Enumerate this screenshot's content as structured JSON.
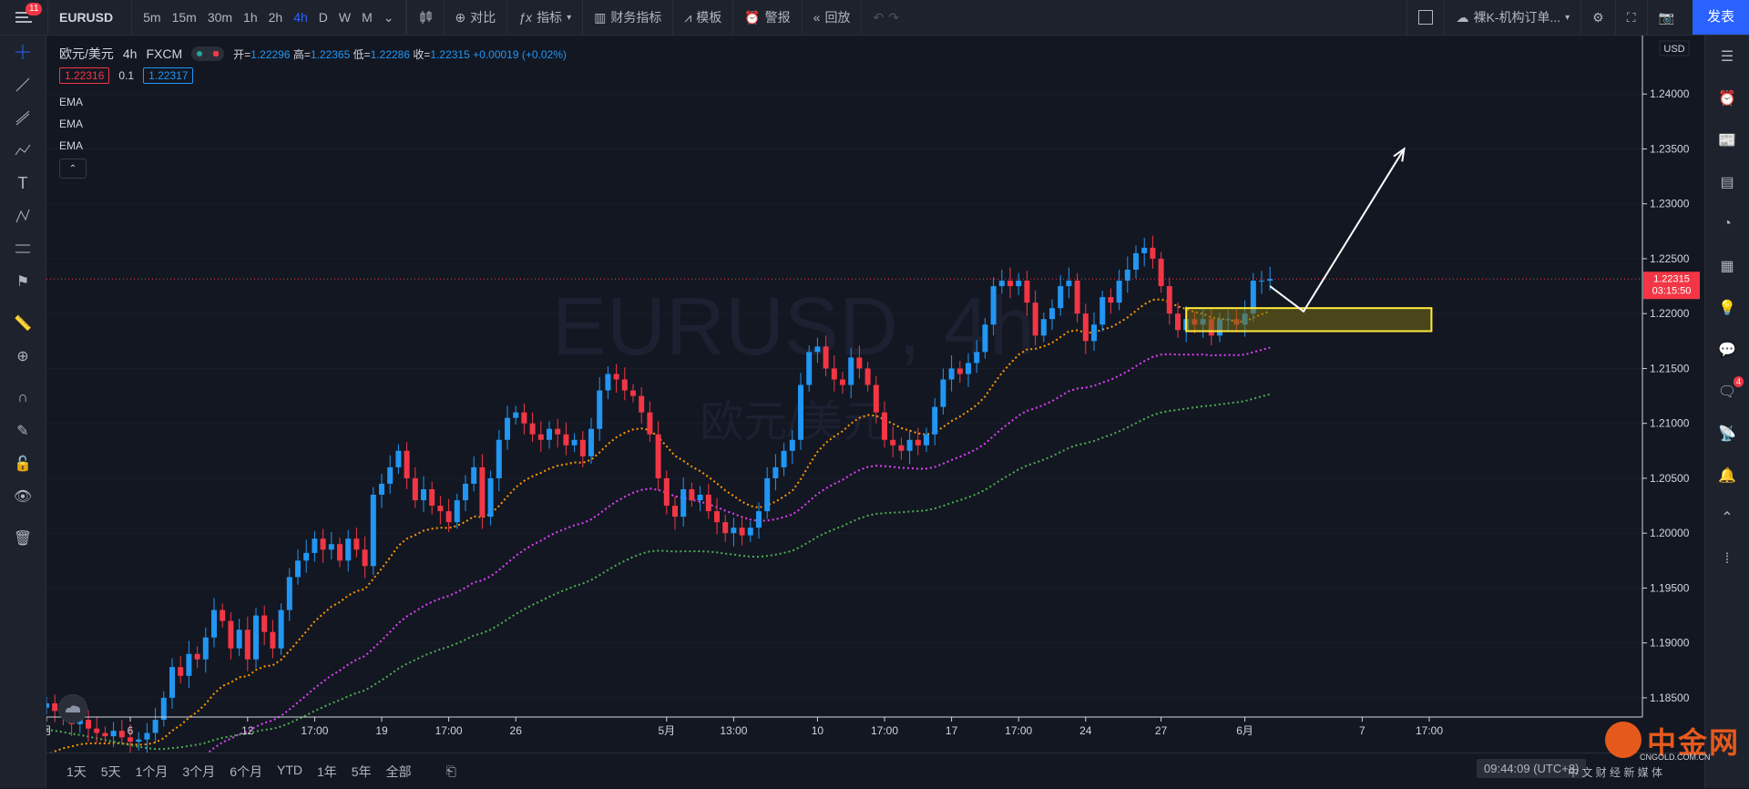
{
  "topbar": {
    "menu_badge": "11",
    "symbol": "EURUSD",
    "intervals": [
      "5m",
      "15m",
      "30m",
      "1h",
      "2h",
      "4h",
      "D",
      "W",
      "M"
    ],
    "active_interval": "4h",
    "compare": "对比",
    "indicators": "指标",
    "financials": "财务指标",
    "template": "模板",
    "alert": "警报",
    "replay": "回放",
    "layout_name": "裸K-机构订单...",
    "publish": "发表"
  },
  "legend": {
    "title": "欧元/美元",
    "interval": "4h",
    "broker": "FXCM",
    "open_label": "开=",
    "open": "1.22296",
    "high_label": "高=",
    "high": "1.22365",
    "low_label": "低=",
    "low": "1.22286",
    "close_label": "收=",
    "close": "1.22315",
    "change": "+0.00019 (+0.02%)",
    "sell": "1.22316",
    "spread": "0.1",
    "buy": "1.22317",
    "indicators": [
      "EMA",
      "EMA",
      "EMA"
    ]
  },
  "watermark": {
    "symbol": "EURUSD, 4h",
    "name": "欧元/美元"
  },
  "chart_data": {
    "type": "candlestick",
    "currency": "USD",
    "last_price": "1.22315",
    "countdown": "03:15:50",
    "y_ticks": [
      "1.24000",
      "1.23500",
      "1.23000",
      "1.22500",
      "1.22000",
      "1.21500",
      "1.21000",
      "1.20500",
      "1.20000",
      "1.19500",
      "1.19000",
      "1.18500"
    ],
    "ylim": [
      1.1835,
      1.2445
    ],
    "x_ticks": [
      {
        "label": "月",
        "i": 0
      },
      {
        "label": "6",
        "i": 10
      },
      {
        "label": "12",
        "i": 24
      },
      {
        "label": "17:00",
        "i": 32
      },
      {
        "label": "19",
        "i": 40
      },
      {
        "label": "17:00",
        "i": 48
      },
      {
        "label": "26",
        "i": 56
      },
      {
        "label": "5月",
        "i": 74
      },
      {
        "label": "13:00",
        "i": 82
      },
      {
        "label": "10",
        "i": 92
      },
      {
        "label": "17:00",
        "i": 100
      },
      {
        "label": "17",
        "i": 108
      },
      {
        "label": "17:00",
        "i": 116
      },
      {
        "label": "24",
        "i": 124
      },
      {
        "label": "27",
        "i": 133
      },
      {
        "label": "6月",
        "i": 143
      },
      {
        "label": "7",
        "i": 157
      },
      {
        "label": "17:00",
        "i": 165
      }
    ],
    "close": [
      1.1845,
      1.1838,
      1.1832,
      1.1826,
      1.183,
      1.1822,
      1.1818,
      1.1815,
      1.182,
      1.1814,
      1.181,
      1.1812,
      1.1818,
      1.183,
      1.185,
      1.1878,
      1.187,
      1.189,
      1.1885,
      1.1905,
      1.193,
      1.192,
      1.1895,
      1.1912,
      1.1885,
      1.1925,
      1.191,
      1.1895,
      1.193,
      1.196,
      1.1975,
      1.1982,
      1.1995,
      1.1985,
      1.199,
      1.1975,
      1.1995,
      1.1985,
      1.197,
      1.2035,
      1.2045,
      1.206,
      1.2075,
      1.205,
      1.203,
      1.204,
      1.2025,
      1.202,
      1.201,
      1.203,
      1.2045,
      1.206,
      1.2015,
      1.205,
      1.2085,
      1.2105,
      1.211,
      1.21,
      1.209,
      1.2085,
      1.2095,
      1.209,
      1.208,
      1.2085,
      1.207,
      1.2095,
      1.213,
      1.2145,
      1.214,
      1.213,
      1.2125,
      1.211,
      1.209,
      1.205,
      1.2025,
      1.2015,
      1.204,
      1.203,
      1.2035,
      1.202,
      1.201,
      1.2,
      1.2005,
      1.1998,
      1.2005,
      1.202,
      1.205,
      1.206,
      1.2075,
      1.2085,
      1.2135,
      1.2165,
      1.217,
      1.215,
      1.214,
      1.2135,
      1.216,
      1.215,
      1.2135,
      1.211,
      1.2085,
      1.208,
      1.2075,
      1.2085,
      1.208,
      1.209,
      1.2115,
      1.214,
      1.215,
      1.2145,
      1.2155,
      1.2165,
      1.219,
      1.2225,
      1.223,
      1.2225,
      1.223,
      1.221,
      1.218,
      1.2195,
      1.2205,
      1.2225,
      1.223,
      1.22,
      1.2175,
      1.219,
      1.2215,
      1.221,
      1.223,
      1.224,
      1.2255,
      1.226,
      1.225,
      1.2225,
      1.22,
      1.2185,
      1.2195,
      1.219,
      1.2195,
      1.218,
      1.2195,
      1.2195,
      1.219,
      1.22,
      1.223,
      1.223,
      1.22315
    ],
    "projection": {
      "from": 1.2225,
      "via": 1.2202,
      "to": 1.235
    },
    "zone": {
      "top": 1.2205,
      "bottom": 1.2184
    },
    "ema_lines": [
      {
        "name": "EMA",
        "color": "#ff9800",
        "start": 1.18,
        "end": 1.219
      },
      {
        "name": "EMA",
        "color": "#e040fb",
        "start": 1.178,
        "end": 1.2172
      },
      {
        "name": "EMA",
        "color": "#4caf50",
        "start": 1.187,
        "end": 1.2155
      }
    ]
  },
  "bottombar": {
    "ranges": [
      "1天",
      "5天",
      "1个月",
      "3个月",
      "6个月",
      "YTD",
      "1年",
      "5年",
      "全部"
    ],
    "clock": "09:44:09 (UTC+8)",
    "misc": "中 文 财 经 新 媒 体"
  },
  "brand": {
    "name": "中金网",
    "url": "CNGOLD.COM.CN"
  },
  "colors": {
    "up": "#2196f3",
    "down": "#f23645",
    "background": "#131722",
    "accent": "#2962ff"
  }
}
